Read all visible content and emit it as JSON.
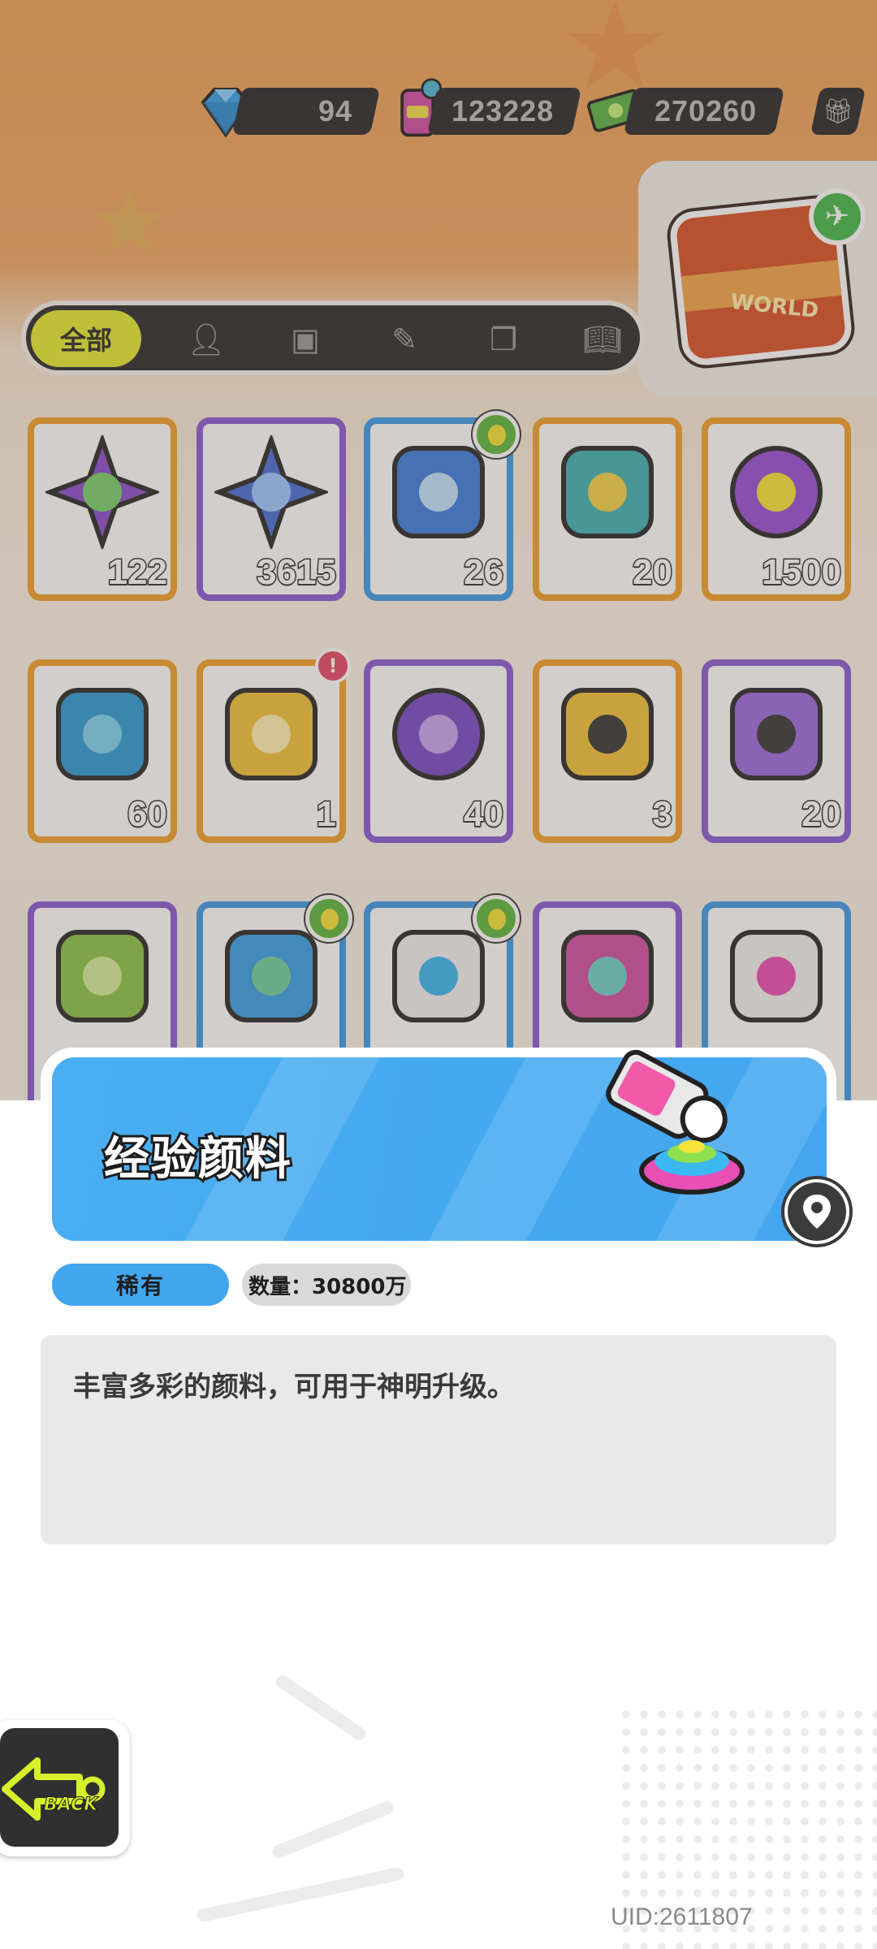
{
  "currency": {
    "gems": "94",
    "paint_cans": "123228",
    "cash": "270260"
  },
  "world_badge": {
    "text": "WORLD"
  },
  "tabs": {
    "all_label": "全部"
  },
  "items": [
    {
      "count": "122",
      "frame": "orange",
      "icon": "purple-star-shard-icon"
    },
    {
      "count": "3615",
      "frame": "purple",
      "icon": "blue-star-shard-icon"
    },
    {
      "count": "26",
      "frame": "blue",
      "icon": "paint-marker-icon"
    },
    {
      "count": "20",
      "frame": "orange",
      "icon": "color-cube-icon"
    },
    {
      "count": "1500",
      "frame": "orange",
      "icon": "cool-paint-blob-icon"
    },
    {
      "count": "60",
      "frame": "orange",
      "icon": "season-ticket-icon"
    },
    {
      "count": "1",
      "frame": "orange",
      "icon": "star-card-icon"
    },
    {
      "count": "40",
      "frame": "purple",
      "icon": "mystery-egg-icon"
    },
    {
      "count": "3",
      "frame": "orange",
      "icon": "deity-puzzle-gold-icon"
    },
    {
      "count": "20",
      "frame": "purple",
      "icon": "deity-puzzle-purple-icon"
    },
    {
      "count": "",
      "frame": "purple",
      "icon": "open-cup-icon"
    },
    {
      "count": "",
      "frame": "blue",
      "icon": "spray-can-blue-icon"
    },
    {
      "count": "",
      "frame": "blue",
      "icon": "paint-tube-icon"
    },
    {
      "count": "",
      "frame": "purple",
      "icon": "spray-can-pink-icon"
    },
    {
      "count": "",
      "frame": "blue",
      "icon": "rainbow-paint-tube-icon"
    }
  ],
  "detail": {
    "name": "经验颜料",
    "rarity": "稀有",
    "quantity": "数量：30800万",
    "description": "丰富多彩的颜料，可用于神明升级。"
  },
  "back_label": "BACK",
  "uid": "UID:2611807",
  "colors": {
    "accent_yellow": "#e5ea34",
    "rarity_blue": "#42a6ef",
    "frame_orange": "#f2a12b",
    "frame_purple": "#8a5cd6",
    "frame_blue": "#3d9be8"
  }
}
